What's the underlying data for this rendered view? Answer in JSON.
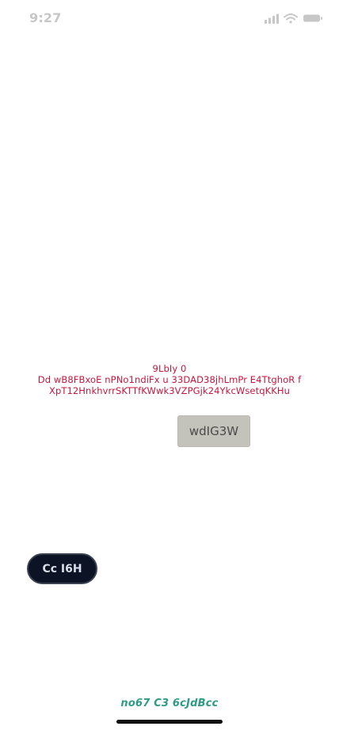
{
  "status_bar": {
    "time": "9:27",
    "icons": [
      "cellular-signal-icon",
      "wifi-icon",
      "battery-icon"
    ],
    "icon_color": "#c7c7c7"
  },
  "content": {
    "text_lines": [
      "9LbIy 0",
      "Dd wB8FBxoE nPNo1ndiFx u 33DAD38jhLmPr E4TtghoR f",
      "XpT12HnkhvrrSKTTfKWwk3VZPGjk24YkcWsetqKKHu"
    ],
    "text_color": "#c6163d",
    "grey_button_label": "wdIG3W",
    "pill_button_label": "Cc I6H",
    "bottom_link_label": "no67 C3 6cJdBcc",
    "bottom_link_color": "#2e9b86"
  }
}
